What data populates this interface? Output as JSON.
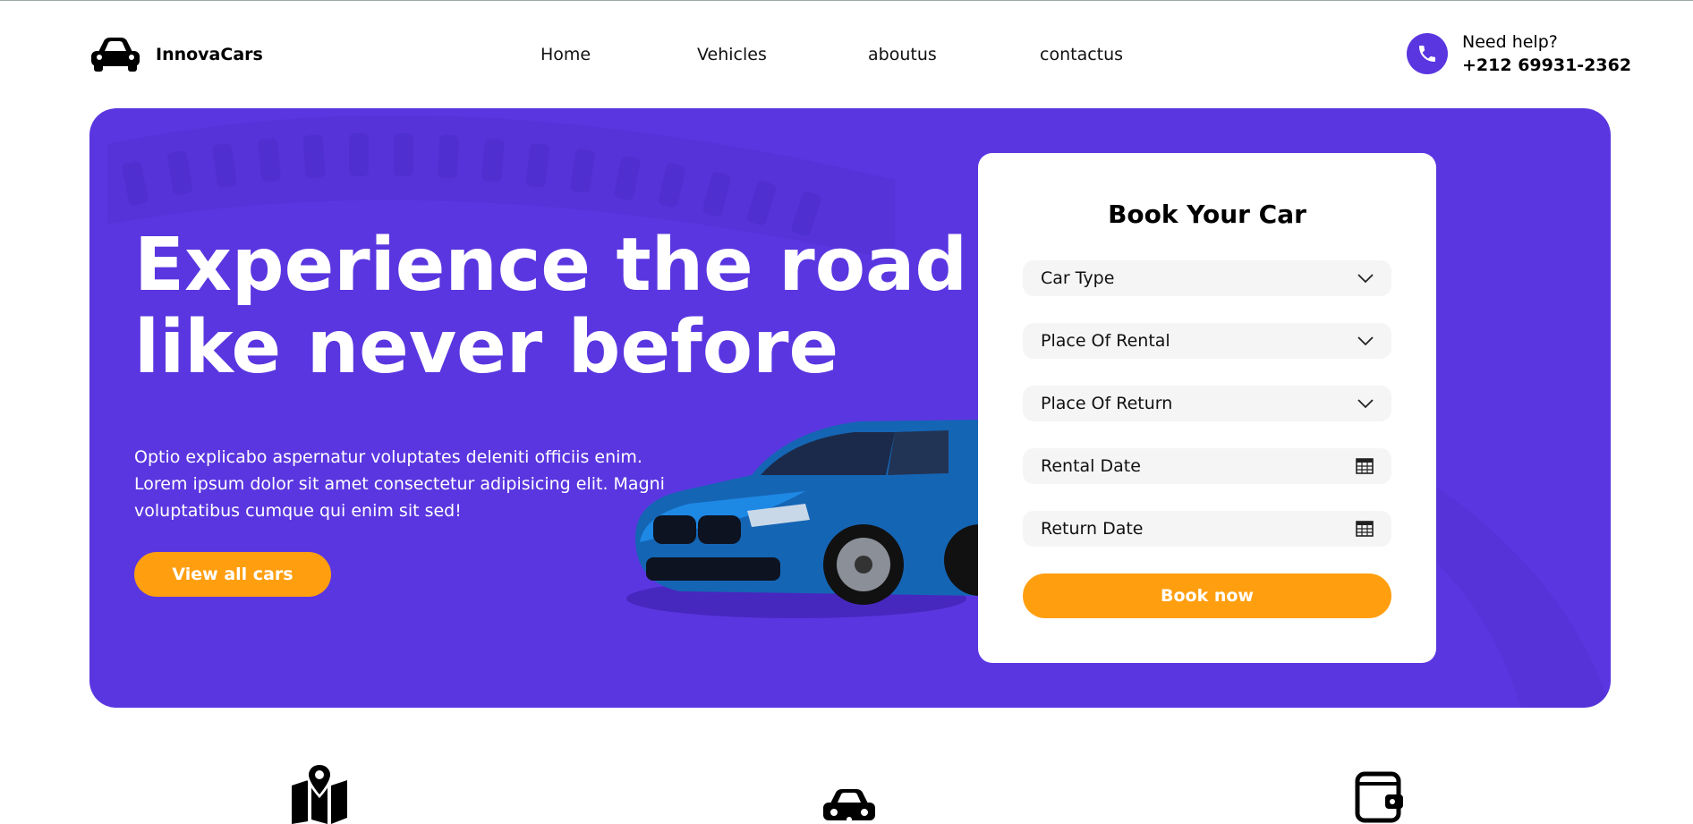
{
  "header": {
    "brand": "InnovaCars",
    "logo_icon": "car-icon",
    "nav": [
      "Home",
      "Vehicles",
      "aboutus",
      "contactus"
    ],
    "help_label": "Need help?",
    "help_number": "+212 69931-2362",
    "phone_icon": "phone-icon"
  },
  "hero": {
    "headline_line1": "Experience the road",
    "headline_line2": "like never before",
    "description": "Optio explicabo aspernatur voluptates deleniti officiis enim. Lorem ipsum dolor sit amet consectetur adipisicing elit. Magni voluptatibus cumque qui enim sit sed!",
    "cta": "View all cars"
  },
  "booking": {
    "title": "Book Your Car",
    "fields": [
      {
        "label": "Car Type",
        "icon": "chevron-down-icon"
      },
      {
        "label": "Place Of Rental",
        "icon": "chevron-down-icon"
      },
      {
        "label": "Place Of Return",
        "icon": "chevron-down-icon"
      },
      {
        "label": "Rental Date",
        "icon": "calendar-icon"
      },
      {
        "label": "Return Date",
        "icon": "calendar-icon"
      }
    ],
    "button": "Book now"
  },
  "features": {
    "icons": [
      "map-pin-icon",
      "car-icon",
      "wallet-icon"
    ]
  },
  "colors": {
    "primary": "#5a36e0",
    "accent": "#ff9f10",
    "field_bg": "#f5f5f6"
  }
}
